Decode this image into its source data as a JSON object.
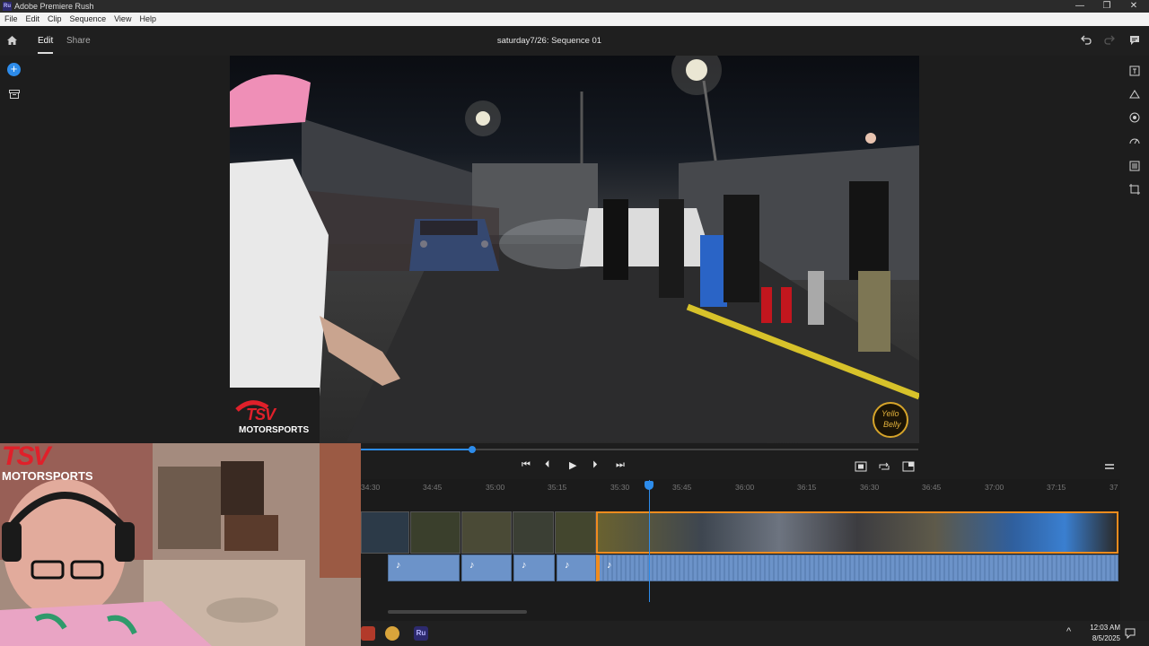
{
  "window": {
    "title": "Adobe Premiere Rush",
    "app_badge": "Ru",
    "min": "—",
    "max": "❐",
    "close": "✕"
  },
  "menu": [
    "File",
    "Edit",
    "Clip",
    "Sequence",
    "View",
    "Help"
  ],
  "header": {
    "tab_edit": "Edit",
    "tab_share": "Share",
    "sequence_title": "saturday7/26: Sequence 01"
  },
  "preview": {
    "watermark_left_top": "TSV",
    "watermark_left_bottom": "MOTORSPORTS",
    "watermark_right_top": "Yello",
    "watermark_right_bottom": "Belly"
  },
  "player": {
    "scrub_fraction": 0.2
  },
  "timeline": {
    "ticks": [
      "34:30",
      "34:45",
      "35:00",
      "35:15",
      "35:30",
      "35:45",
      "36:00",
      "36:15",
      "36:30",
      "36:45",
      "37:00",
      "37:15",
      "37"
    ],
    "audio_note": "♪"
  },
  "webcam": {
    "overlay_top": "TSV",
    "overlay_bottom": "MOTORSPORTS"
  },
  "taskbar": {
    "time": "12:03 AM",
    "date": "8/5/2025",
    "ru_label": "Ru"
  },
  "colors": {
    "accent": "#2d8ceb",
    "selected_clip": "#f08c1e",
    "audio_clip": "#6c93c9",
    "tsv_red": "#e0202a"
  }
}
